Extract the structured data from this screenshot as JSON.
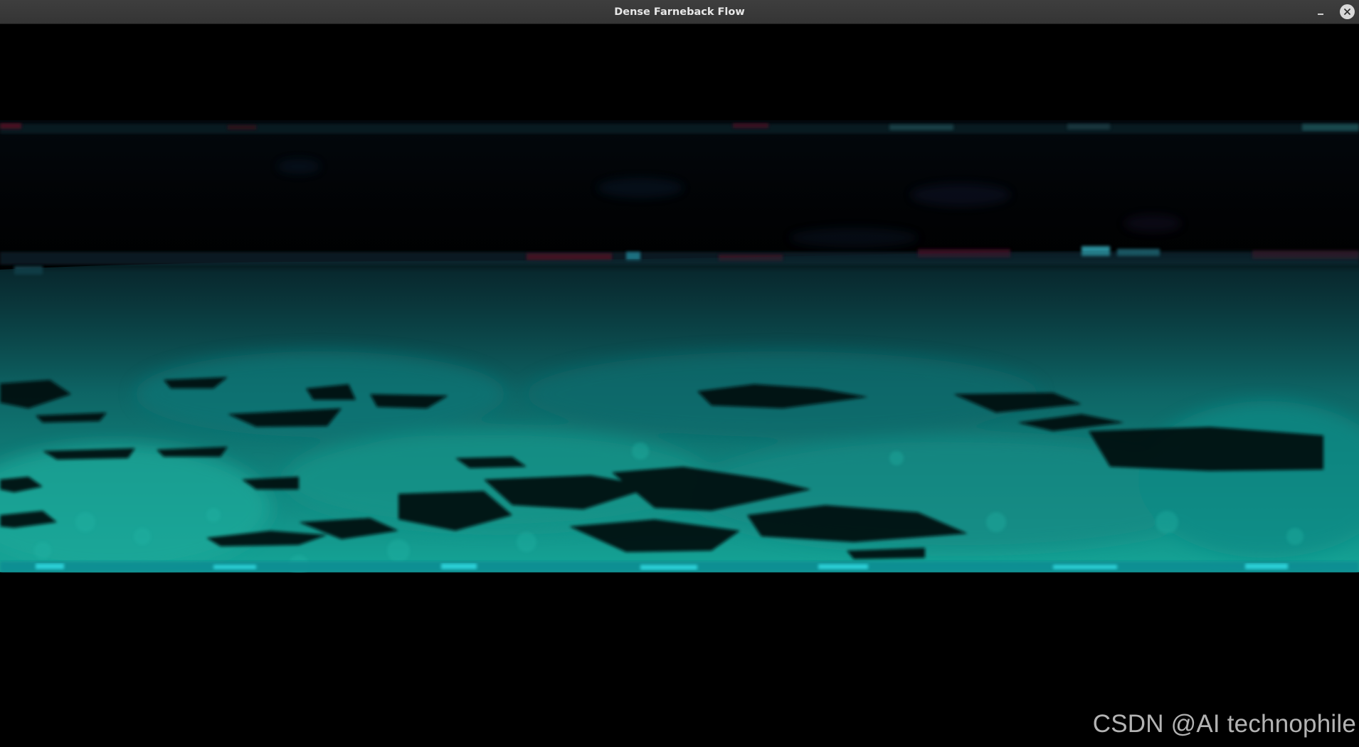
{
  "window": {
    "title": "Dense Farneback Flow"
  },
  "controls": {
    "minimize_icon": "minus-icon",
    "close_icon": "close-icon"
  },
  "canvas": {
    "content": "optical-flow-visualization",
    "colors": {
      "background": "#000000",
      "flow_teal": "#1aa39a",
      "flow_cyan_edge": "#27d6e0",
      "flow_red_specks": "#7a1420"
    }
  },
  "watermark": {
    "text": "CSDN @AI technophile"
  }
}
